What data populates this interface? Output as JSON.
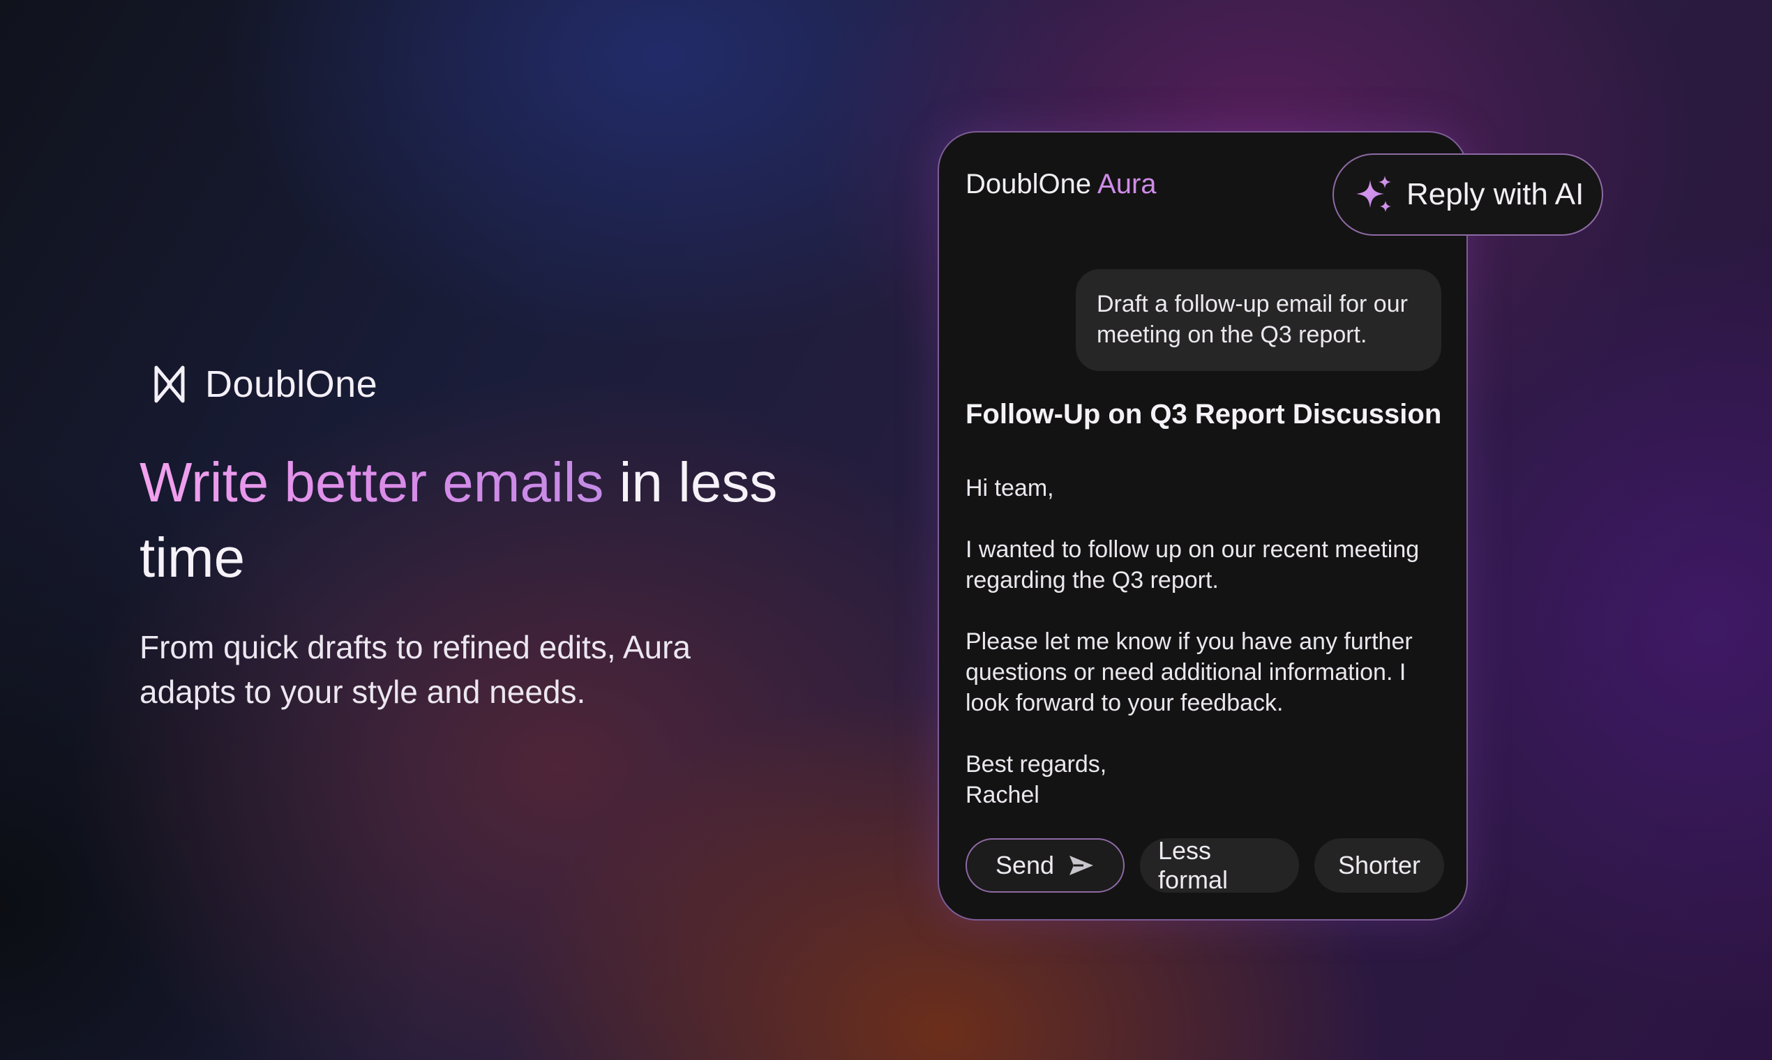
{
  "brand": {
    "name": "DoublOne",
    "icon": "doublone-logo-icon"
  },
  "hero": {
    "headline_accent": "Write better emails",
    "headline_rest": " in less time",
    "subhead": "From quick drafts to refined edits, Aura adapts to your style and needs."
  },
  "card": {
    "title_prefix": "DoublOne ",
    "title_accent": "Aura",
    "reply_ai_label": "Reply with AI",
    "reply_ai_icon": "sparkle-icon",
    "prompt": "Draft a follow-up email for our meeting on the Q3 report.",
    "email": {
      "subject": "Follow-Up on Q3 Report Discussion",
      "greeting": "Hi team,",
      "para1": "I wanted to follow up on our recent meeting regarding the Q3 report.",
      "para2": "Please let me know if you have any further questions or need additional information. I look forward to your feedback.",
      "signoff": "Best regards,",
      "signature": "Rachel"
    },
    "actions": {
      "send": "Send",
      "send_icon": "send-icon",
      "less_formal": "Less formal",
      "shorter": "Shorter"
    }
  },
  "colors": {
    "accent_pink": "#f3a2ee",
    "accent_purple": "#cf8ce9",
    "card_bg": "#131313",
    "card_border": "#7d5c95"
  }
}
